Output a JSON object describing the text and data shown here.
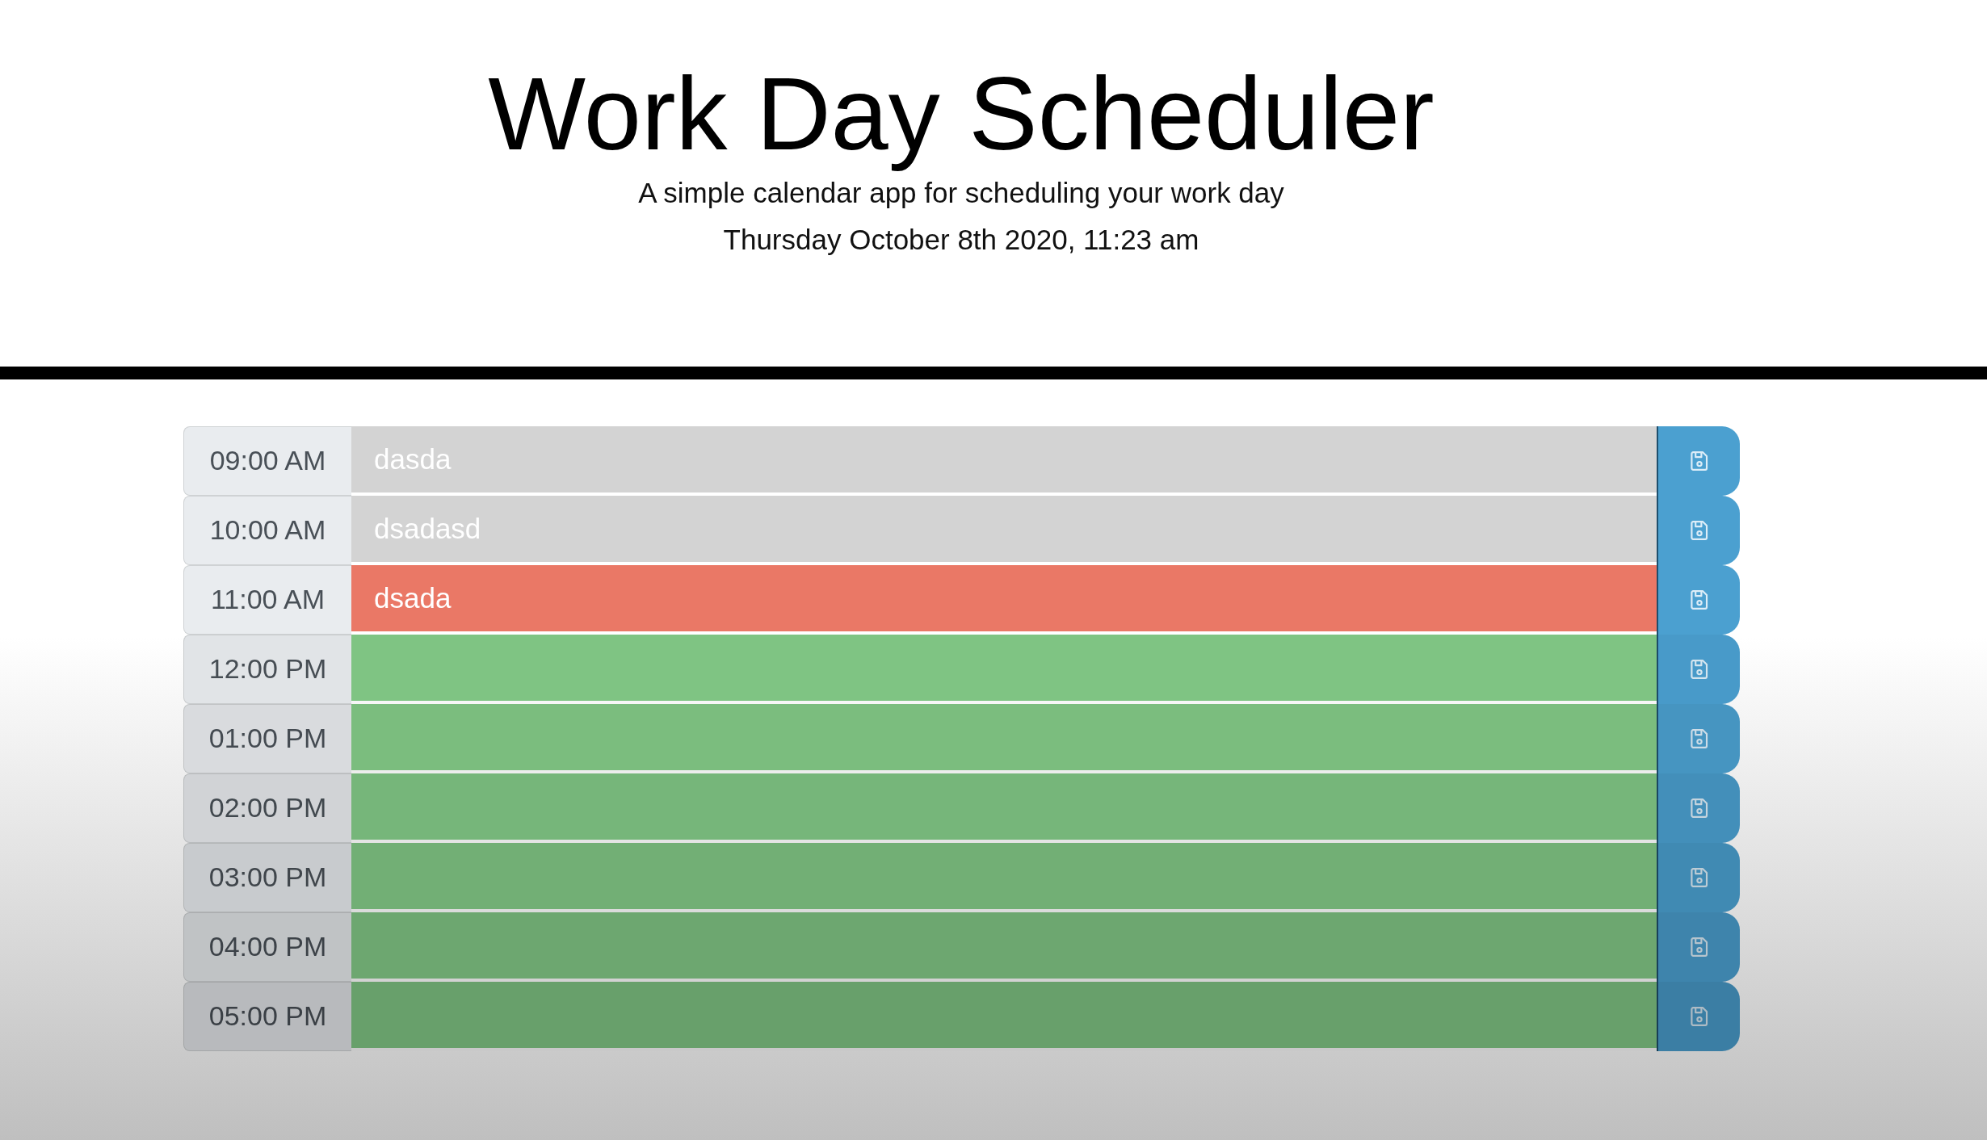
{
  "header": {
    "title": "Work Day Scheduler",
    "subtitle": "A simple calendar app for scheduling your work day",
    "current_date": "Thursday October 8th 2020, 11:23 am"
  },
  "time_blocks": [
    {
      "hour": "09:00 AM",
      "kind": "past",
      "value": "dasda"
    },
    {
      "hour": "10:00 AM",
      "kind": "past",
      "value": "dsadasd"
    },
    {
      "hour": "11:00 AM",
      "kind": "present",
      "value": "dsada"
    },
    {
      "hour": "12:00 PM",
      "kind": "future"
    },
    {
      "hour": "01:00 PM",
      "kind": "future"
    },
    {
      "hour": "02:00 PM",
      "kind": "future"
    },
    {
      "hour": "03:00 PM",
      "kind": "future"
    },
    {
      "hour": "04:00 PM",
      "kind": "future"
    },
    {
      "hour": "05:00 PM",
      "kind": "future"
    }
  ]
}
